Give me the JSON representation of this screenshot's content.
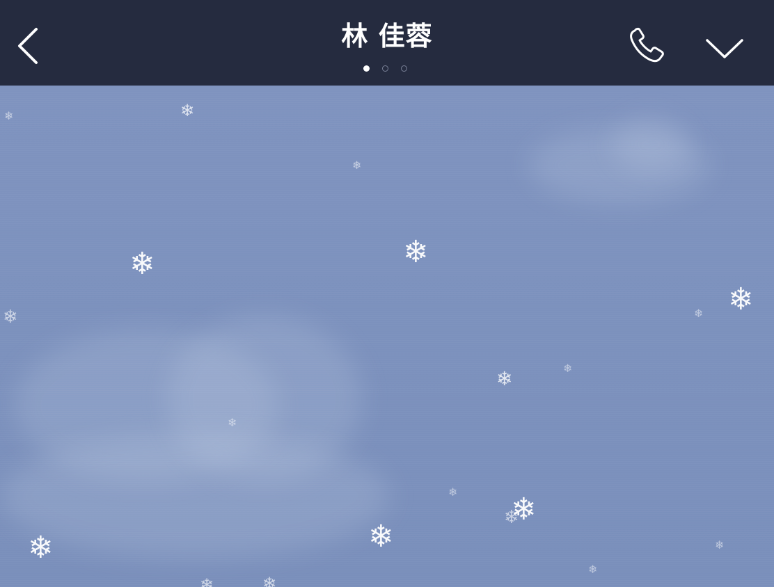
{
  "header": {
    "title": "林 佳蓉",
    "page_indicator": {
      "total": 3,
      "active": 1
    },
    "icons": {
      "back": "chevron-left-icon",
      "call": "phone-icon",
      "menu": "chevron-down-icon"
    },
    "colors": {
      "header_bg": "#252b3f",
      "chat_bg": "#7b90bb",
      "icon": "#ffffff"
    }
  }
}
